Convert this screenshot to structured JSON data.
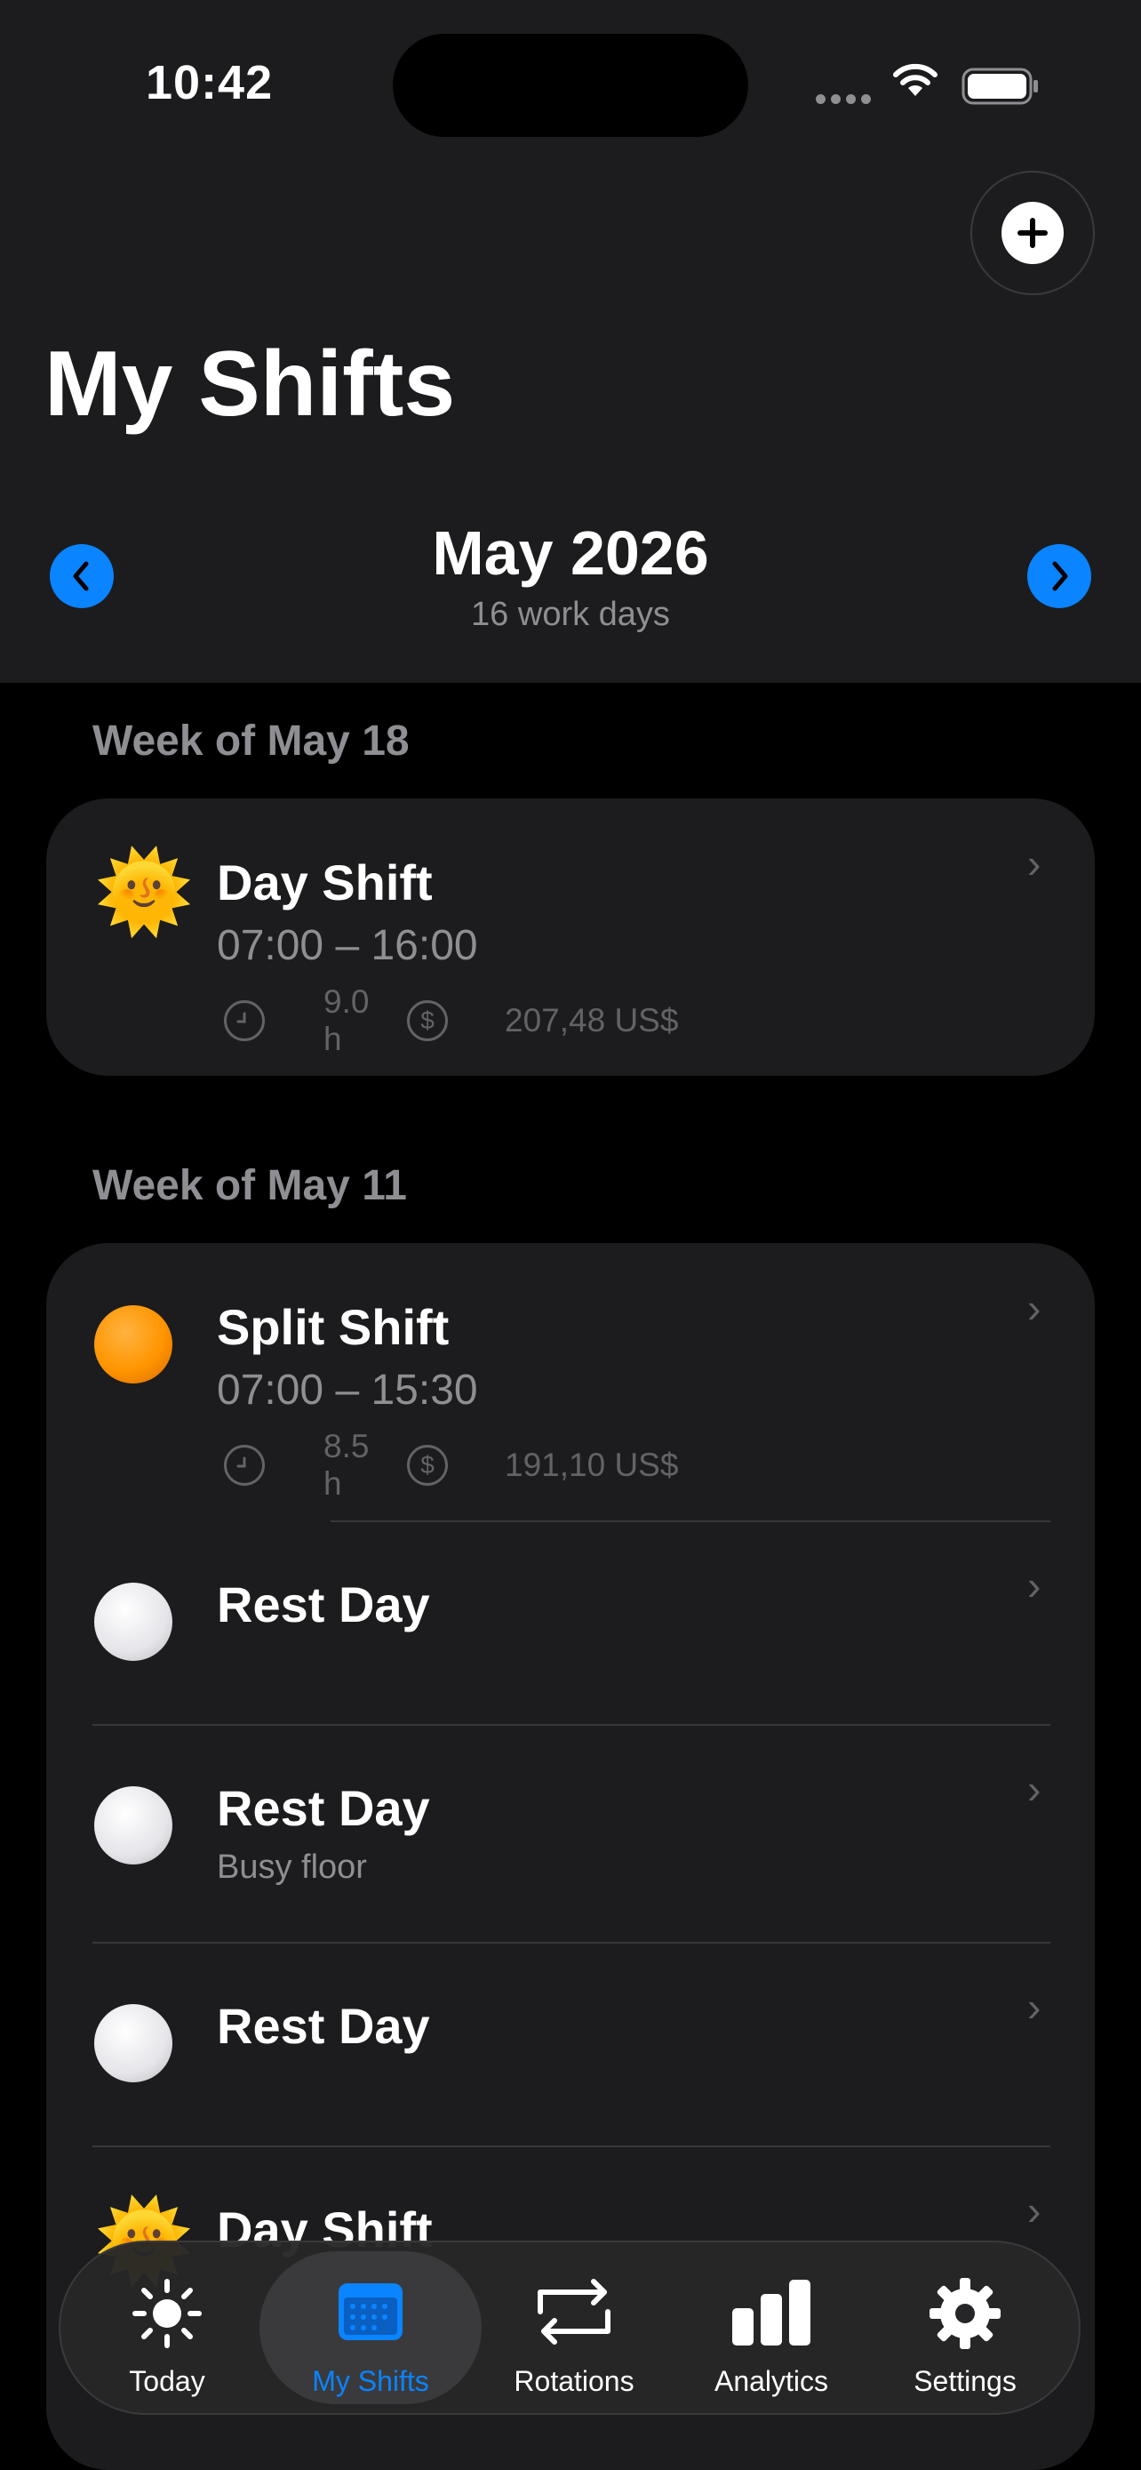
{
  "status_bar": {
    "time": "10:42"
  },
  "header": {
    "title": "My Shifts",
    "month": "May 2026",
    "subtitle": "16 work days"
  },
  "colors": {
    "accent": "#0a84ff",
    "background": "#000000",
    "card": "#1c1c1e",
    "secondary_text": "#8e8e93"
  },
  "sections": [
    {
      "title": "Week of May 18",
      "rows": [
        {
          "icon": "sun-face-icon",
          "title": "Day Shift",
          "time": "07:00 – 16:00",
          "hours": "9.0 h",
          "pay": "207,48 US$"
        }
      ]
    },
    {
      "title": "Week of May 11",
      "rows": [
        {
          "icon": "orange-circle-icon",
          "title": "Split Shift",
          "time": "07:00 – 15:30",
          "hours": "8.5 h",
          "pay": "191,10 US$"
        },
        {
          "icon": "white-circle-icon",
          "title": "Rest Day"
        },
        {
          "icon": "white-circle-icon",
          "title": "Rest Day",
          "note": "Busy floor"
        },
        {
          "icon": "white-circle-icon",
          "title": "Rest Day"
        },
        {
          "icon": "sun-face-icon",
          "title": "Day Shift"
        }
      ]
    }
  ],
  "tabs": [
    {
      "label": "Today",
      "icon": "sun-icon"
    },
    {
      "label": "My Shifts",
      "icon": "calendar-icon",
      "active": true
    },
    {
      "label": "Rotations",
      "icon": "rotation-arrows-icon"
    },
    {
      "label": "Analytics",
      "icon": "bar-chart-icon"
    },
    {
      "label": "Settings",
      "icon": "gear-icon"
    }
  ]
}
